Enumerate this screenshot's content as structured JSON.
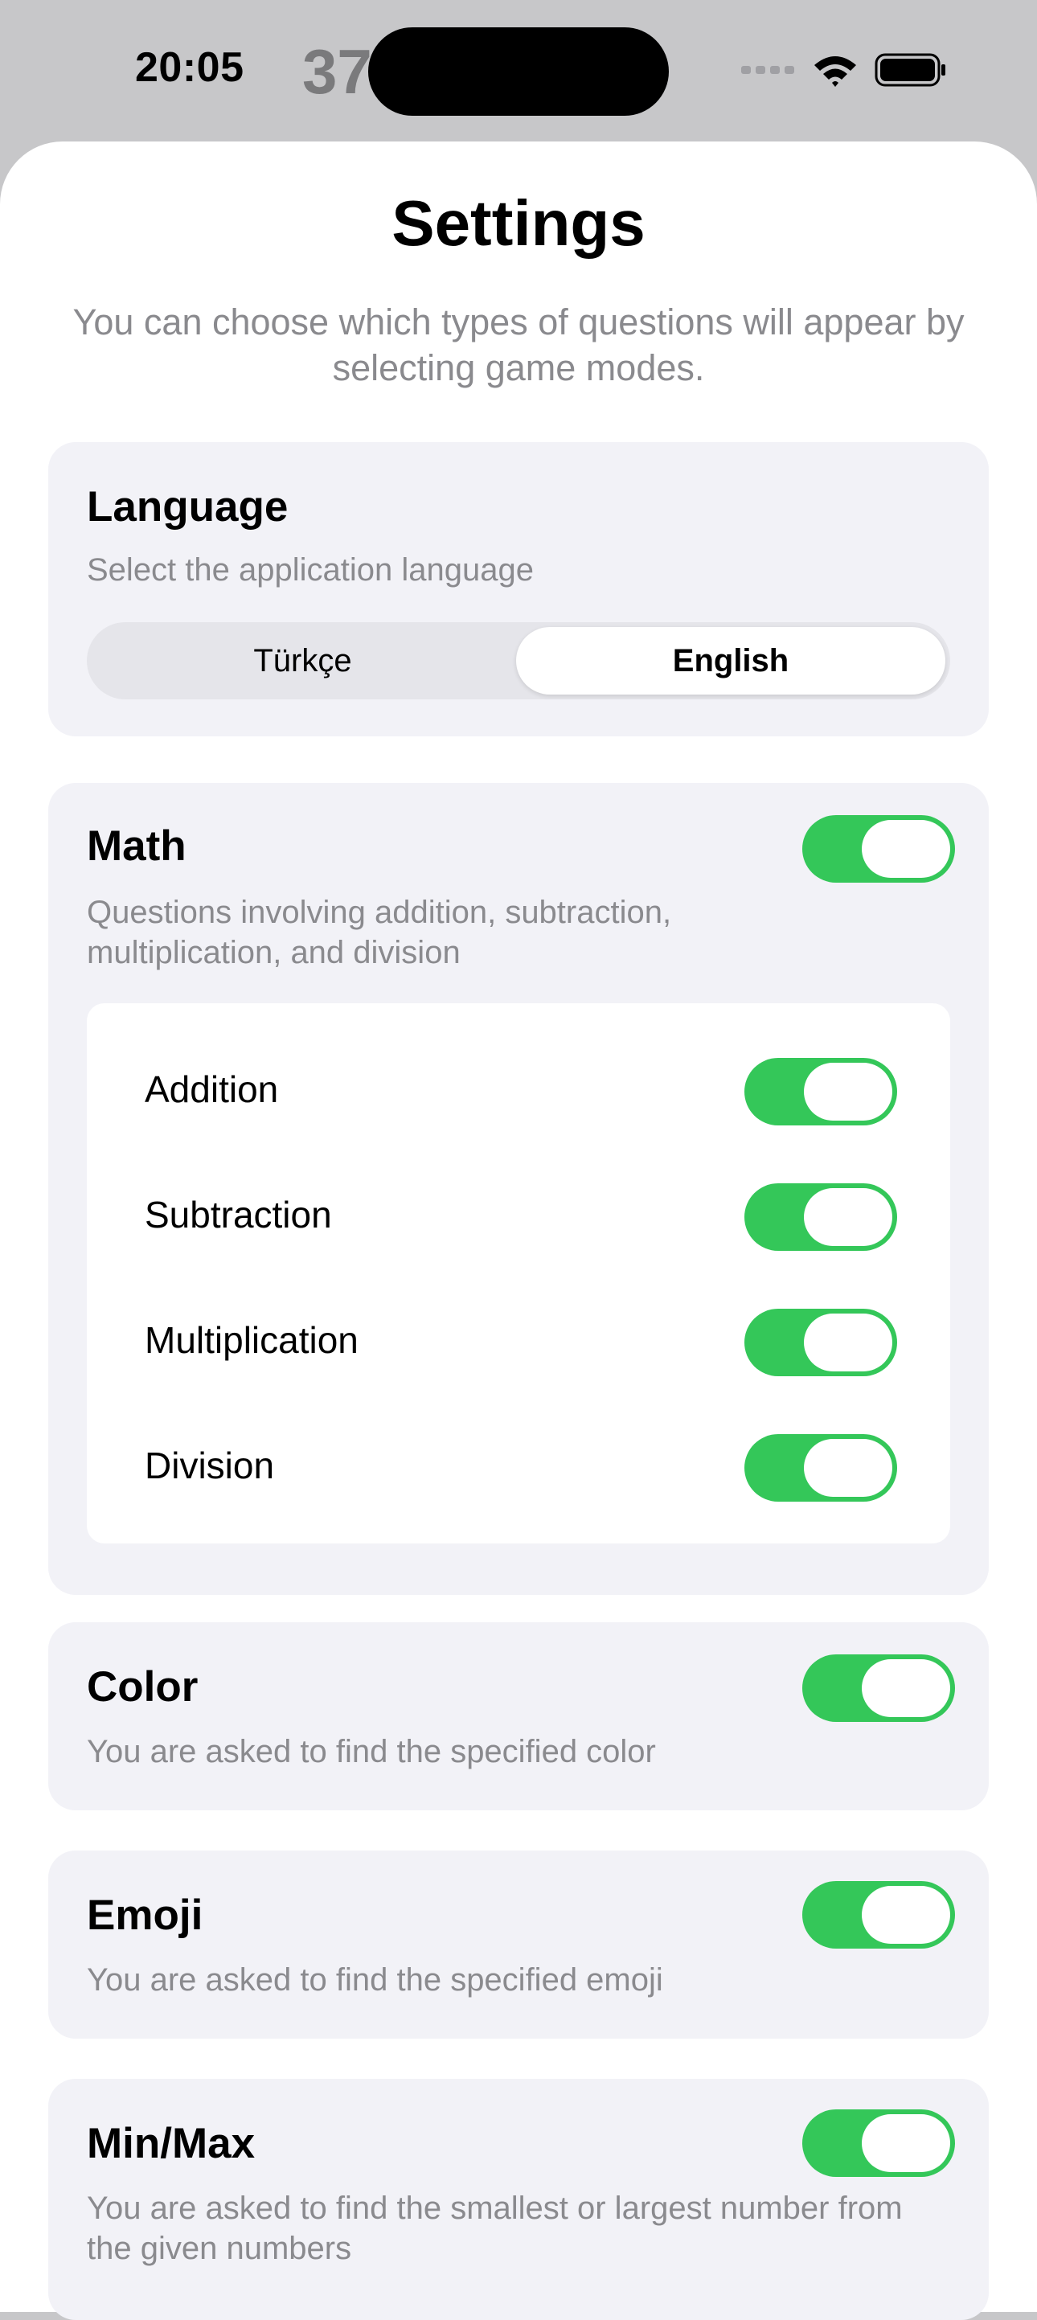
{
  "status_bar": {
    "time": "20:05",
    "ghost_text": "37",
    "icons": [
      "cellular-dots-icon",
      "wifi-icon",
      "battery-icon"
    ]
  },
  "header": {
    "title": "Settings",
    "subtitle": "You can choose which types of questions will appear by selecting game modes."
  },
  "language": {
    "title": "Language",
    "description": "Select the application language",
    "options": [
      "Türkçe",
      "English"
    ],
    "selected": "English"
  },
  "math": {
    "title": "Math",
    "description": "Questions involving addition, subtraction, multiplication, and division",
    "enabled": true,
    "operations": [
      {
        "label": "Addition",
        "enabled": true
      },
      {
        "label": "Subtraction",
        "enabled": true
      },
      {
        "label": "Multiplication",
        "enabled": true
      },
      {
        "label": "Division",
        "enabled": true
      }
    ]
  },
  "color_mode": {
    "title": "Color",
    "description": "You are asked to find the specified color",
    "enabled": true
  },
  "emoji_mode": {
    "title": "Emoji",
    "description": "You are asked to find the specified emoji",
    "enabled": true
  },
  "minmax_mode": {
    "title": "Min/Max",
    "description": "You are asked to find the smallest or largest number from the given numbers",
    "enabled": true
  },
  "colors": {
    "toggle_on": "#34c759",
    "card_background": "#f2f2f7",
    "secondary_text": "#8a8a8e"
  }
}
